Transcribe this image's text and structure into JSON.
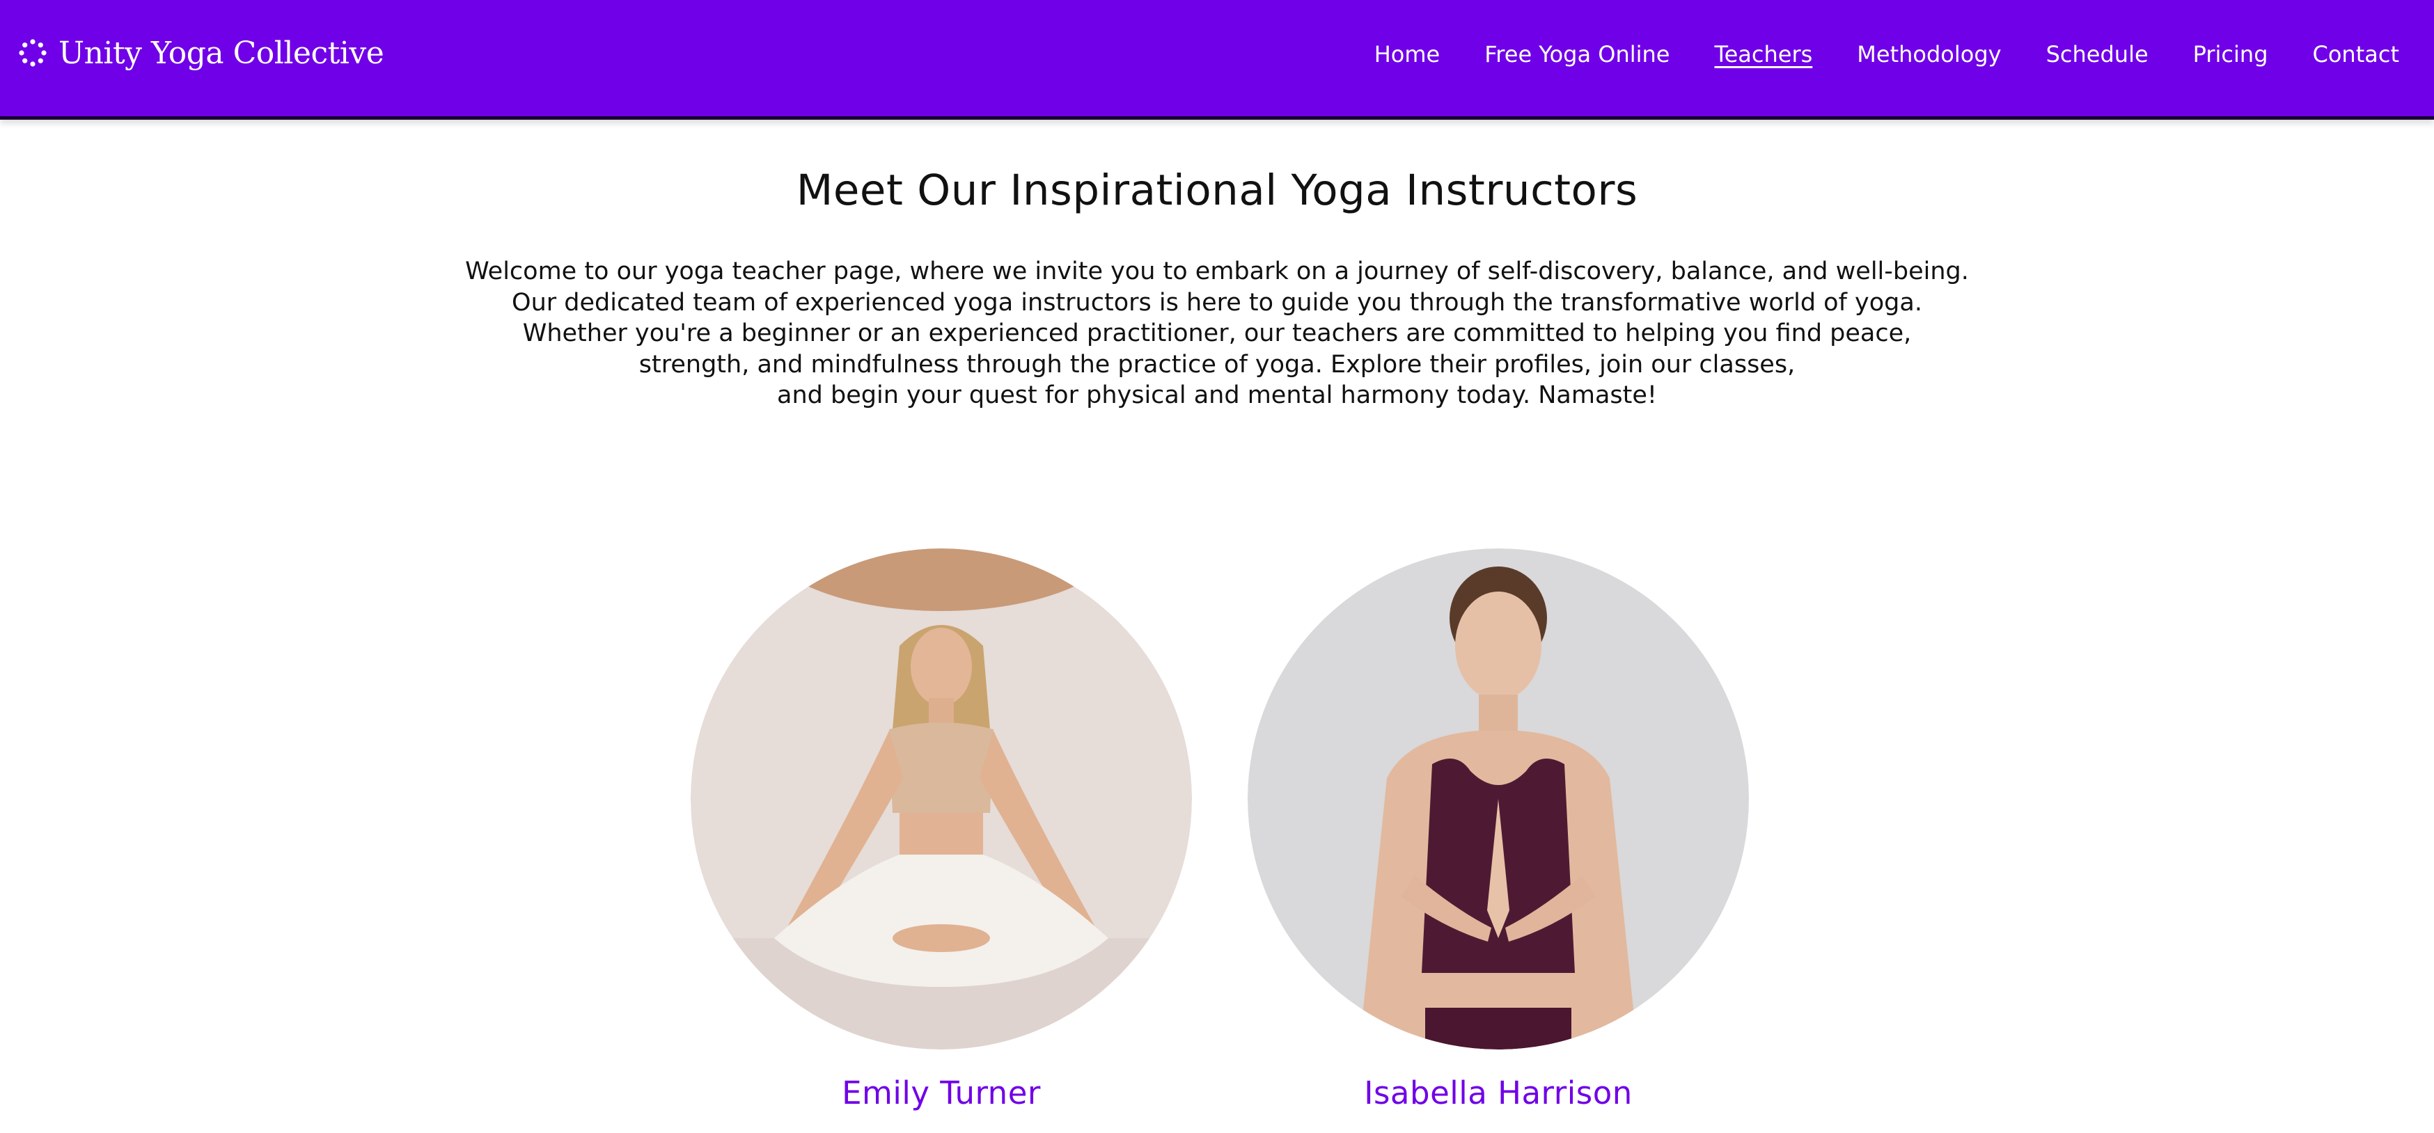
{
  "brand": {
    "name": "Unity Yoga Collective",
    "logo_icon": "lotus-dots-icon"
  },
  "nav": {
    "items": [
      {
        "label": "Home"
      },
      {
        "label": "Free Yoga Online"
      },
      {
        "label": "Teachers",
        "active": true
      },
      {
        "label": "Methodology"
      },
      {
        "label": "Schedule"
      },
      {
        "label": "Pricing"
      },
      {
        "label": "Contact"
      }
    ]
  },
  "main": {
    "headline": "Meet Our Inspirational Yoga Instructors",
    "intro_lines": [
      "Welcome to our yoga teacher page, where we invite you to embark on a journey of self-discovery, balance, and well-being.",
      "Our dedicated team of experienced yoga instructors is here to guide you through the transformative world of yoga.",
      "Whether you're a beginner or an experienced practitioner, our teachers are committed to helping you find peace,",
      "strength, and mindfulness through the practice of yoga. Explore their profiles, join our classes,",
      "and begin your quest for physical and mental harmony today. Namaste!"
    ]
  },
  "teachers": [
    {
      "name": "Emily Turner"
    },
    {
      "name": "Isabella Harrison"
    }
  ],
  "colors": {
    "brand_purple": "#7000e8",
    "header_text": "#ffffff",
    "body_text": "#111111",
    "teacher_name": "#7000e8"
  }
}
